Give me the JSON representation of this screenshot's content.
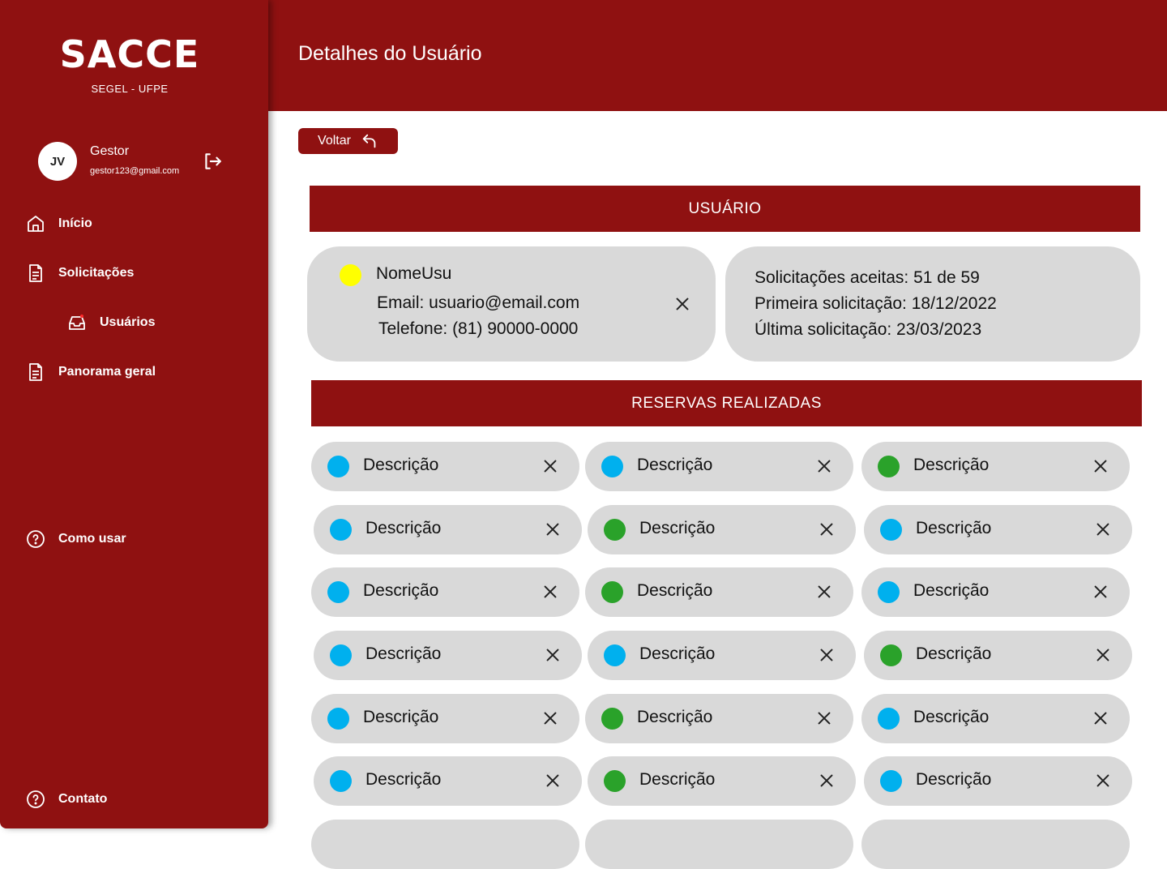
{
  "sidebar": {
    "brand_title": "SACCE",
    "brand_subtitle": "SEGEL - UFPE",
    "user": {
      "initials": "JV",
      "role": "Gestor",
      "email": "gestor123@gmail.com"
    },
    "nav": {
      "inicio": "Início",
      "solicitacoes": "Solicitações",
      "usuarios": "Usuários",
      "panorama": "Panorama geral",
      "como_usar": "Como usar",
      "contato": "Contato"
    }
  },
  "header": {
    "title": "Detalhes do Usuário"
  },
  "back_button": {
    "label": "Voltar"
  },
  "user_section": {
    "title": "USUÁRIO",
    "status_color": "#ffff00",
    "name": "NomeUsu",
    "email_line": "Email: usuario@email.com",
    "phone_line": "Telefone: (81) 90000-0000",
    "stats": {
      "accepted": "Solicitações aceitas: 51 de 59",
      "first": "Primeira solicitação: 18/12/2022",
      "last": "Última solicitação: 23/03/2023"
    }
  },
  "reservations": {
    "title": "RESERVAS REALIZADAS",
    "colors": {
      "blue": "#00b0ee",
      "green": "#2aa22a"
    },
    "items": [
      {
        "label": "Descrição",
        "status": "blue"
      },
      {
        "label": "Descrição",
        "status": "blue"
      },
      {
        "label": "Descrição",
        "status": "green"
      },
      {
        "label": "Descrição",
        "status": "blue"
      },
      {
        "label": "Descrição",
        "status": "green"
      },
      {
        "label": "Descrição",
        "status": "blue"
      },
      {
        "label": "Descrição",
        "status": "blue"
      },
      {
        "label": "Descrição",
        "status": "green"
      },
      {
        "label": "Descrição",
        "status": "blue"
      },
      {
        "label": "Descrição",
        "status": "blue"
      },
      {
        "label": "Descrição",
        "status": "blue"
      },
      {
        "label": "Descrição",
        "status": "green"
      },
      {
        "label": "Descrição",
        "status": "blue"
      },
      {
        "label": "Descrição",
        "status": "green"
      },
      {
        "label": "Descrição",
        "status": "blue"
      },
      {
        "label": "Descrição",
        "status": "blue"
      },
      {
        "label": "Descrição",
        "status": "green"
      },
      {
        "label": "Descrição",
        "status": "blue"
      }
    ]
  },
  "accent_color": "#8f1111"
}
